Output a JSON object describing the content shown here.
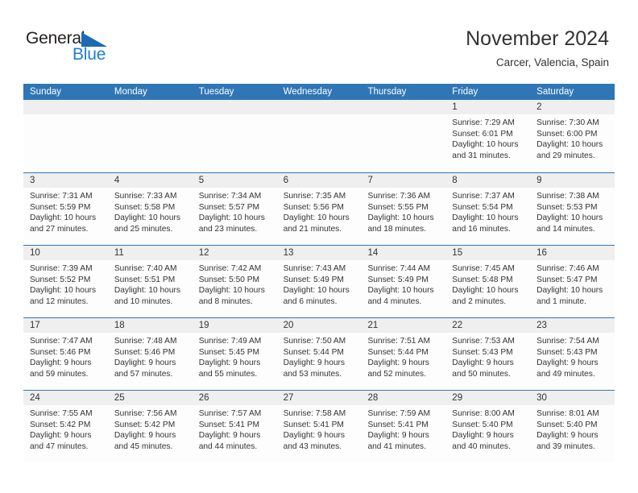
{
  "logo": {
    "word_one": "General",
    "word_two": "Blue",
    "triangle_icon": "blue-triangle-icon",
    "brand_dark": "#231f20",
    "brand_blue": "#1b7fd4",
    "triangle_blue": "#1b6ab3"
  },
  "header": {
    "title": "November 2024",
    "subtitle": "Carcer, Valencia, Spain"
  },
  "theme": {
    "header_bar": "#2f76b6",
    "day_band": "#efefef",
    "cell_bg": "#fdfdfd",
    "text": "#333333"
  },
  "calendar": {
    "day_headers": [
      "Sunday",
      "Monday",
      "Tuesday",
      "Wednesday",
      "Thursday",
      "Friday",
      "Saturday"
    ],
    "weeks": [
      [
        {
          "day": "",
          "lines": []
        },
        {
          "day": "",
          "lines": []
        },
        {
          "day": "",
          "lines": []
        },
        {
          "day": "",
          "lines": []
        },
        {
          "day": "",
          "lines": []
        },
        {
          "day": "1",
          "lines": [
            "Sunrise: 7:29 AM",
            "Sunset: 6:01 PM",
            "Daylight: 10 hours",
            "and 31 minutes."
          ]
        },
        {
          "day": "2",
          "lines": [
            "Sunrise: 7:30 AM",
            "Sunset: 6:00 PM",
            "Daylight: 10 hours",
            "and 29 minutes."
          ]
        }
      ],
      [
        {
          "day": "3",
          "lines": [
            "Sunrise: 7:31 AM",
            "Sunset: 5:59 PM",
            "Daylight: 10 hours",
            "and 27 minutes."
          ]
        },
        {
          "day": "4",
          "lines": [
            "Sunrise: 7:33 AM",
            "Sunset: 5:58 PM",
            "Daylight: 10 hours",
            "and 25 minutes."
          ]
        },
        {
          "day": "5",
          "lines": [
            "Sunrise: 7:34 AM",
            "Sunset: 5:57 PM",
            "Daylight: 10 hours",
            "and 23 minutes."
          ]
        },
        {
          "day": "6",
          "lines": [
            "Sunrise: 7:35 AM",
            "Sunset: 5:56 PM",
            "Daylight: 10 hours",
            "and 21 minutes."
          ]
        },
        {
          "day": "7",
          "lines": [
            "Sunrise: 7:36 AM",
            "Sunset: 5:55 PM",
            "Daylight: 10 hours",
            "and 18 minutes."
          ]
        },
        {
          "day": "8",
          "lines": [
            "Sunrise: 7:37 AM",
            "Sunset: 5:54 PM",
            "Daylight: 10 hours",
            "and 16 minutes."
          ]
        },
        {
          "day": "9",
          "lines": [
            "Sunrise: 7:38 AM",
            "Sunset: 5:53 PM",
            "Daylight: 10 hours",
            "and 14 minutes."
          ]
        }
      ],
      [
        {
          "day": "10",
          "lines": [
            "Sunrise: 7:39 AM",
            "Sunset: 5:52 PM",
            "Daylight: 10 hours",
            "and 12 minutes."
          ]
        },
        {
          "day": "11",
          "lines": [
            "Sunrise: 7:40 AM",
            "Sunset: 5:51 PM",
            "Daylight: 10 hours",
            "and 10 minutes."
          ]
        },
        {
          "day": "12",
          "lines": [
            "Sunrise: 7:42 AM",
            "Sunset: 5:50 PM",
            "Daylight: 10 hours",
            "and 8 minutes."
          ]
        },
        {
          "day": "13",
          "lines": [
            "Sunrise: 7:43 AM",
            "Sunset: 5:49 PM",
            "Daylight: 10 hours",
            "and 6 minutes."
          ]
        },
        {
          "day": "14",
          "lines": [
            "Sunrise: 7:44 AM",
            "Sunset: 5:49 PM",
            "Daylight: 10 hours",
            "and 4 minutes."
          ]
        },
        {
          "day": "15",
          "lines": [
            "Sunrise: 7:45 AM",
            "Sunset: 5:48 PM",
            "Daylight: 10 hours",
            "and 2 minutes."
          ]
        },
        {
          "day": "16",
          "lines": [
            "Sunrise: 7:46 AM",
            "Sunset: 5:47 PM",
            "Daylight: 10 hours",
            "and 1 minute."
          ]
        }
      ],
      [
        {
          "day": "17",
          "lines": [
            "Sunrise: 7:47 AM",
            "Sunset: 5:46 PM",
            "Daylight: 9 hours",
            "and 59 minutes."
          ]
        },
        {
          "day": "18",
          "lines": [
            "Sunrise: 7:48 AM",
            "Sunset: 5:46 PM",
            "Daylight: 9 hours",
            "and 57 minutes."
          ]
        },
        {
          "day": "19",
          "lines": [
            "Sunrise: 7:49 AM",
            "Sunset: 5:45 PM",
            "Daylight: 9 hours",
            "and 55 minutes."
          ]
        },
        {
          "day": "20",
          "lines": [
            "Sunrise: 7:50 AM",
            "Sunset: 5:44 PM",
            "Daylight: 9 hours",
            "and 53 minutes."
          ]
        },
        {
          "day": "21",
          "lines": [
            "Sunrise: 7:51 AM",
            "Sunset: 5:44 PM",
            "Daylight: 9 hours",
            "and 52 minutes."
          ]
        },
        {
          "day": "22",
          "lines": [
            "Sunrise: 7:53 AM",
            "Sunset: 5:43 PM",
            "Daylight: 9 hours",
            "and 50 minutes."
          ]
        },
        {
          "day": "23",
          "lines": [
            "Sunrise: 7:54 AM",
            "Sunset: 5:43 PM",
            "Daylight: 9 hours",
            "and 49 minutes."
          ]
        }
      ],
      [
        {
          "day": "24",
          "lines": [
            "Sunrise: 7:55 AM",
            "Sunset: 5:42 PM",
            "Daylight: 9 hours",
            "and 47 minutes."
          ]
        },
        {
          "day": "25",
          "lines": [
            "Sunrise: 7:56 AM",
            "Sunset: 5:42 PM",
            "Daylight: 9 hours",
            "and 45 minutes."
          ]
        },
        {
          "day": "26",
          "lines": [
            "Sunrise: 7:57 AM",
            "Sunset: 5:41 PM",
            "Daylight: 9 hours",
            "and 44 minutes."
          ]
        },
        {
          "day": "27",
          "lines": [
            "Sunrise: 7:58 AM",
            "Sunset: 5:41 PM",
            "Daylight: 9 hours",
            "and 43 minutes."
          ]
        },
        {
          "day": "28",
          "lines": [
            "Sunrise: 7:59 AM",
            "Sunset: 5:41 PM",
            "Daylight: 9 hours",
            "and 41 minutes."
          ]
        },
        {
          "day": "29",
          "lines": [
            "Sunrise: 8:00 AM",
            "Sunset: 5:40 PM",
            "Daylight: 9 hours",
            "and 40 minutes."
          ]
        },
        {
          "day": "30",
          "lines": [
            "Sunrise: 8:01 AM",
            "Sunset: 5:40 PM",
            "Daylight: 9 hours",
            "and 39 minutes."
          ]
        }
      ]
    ]
  }
}
